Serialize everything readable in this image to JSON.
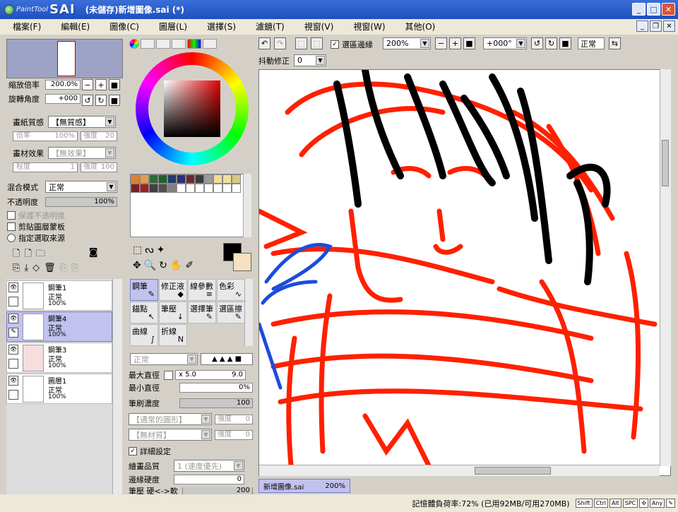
{
  "window": {
    "logo_small": "PaintTool",
    "logo_big": "SAI",
    "title": "(未儲存)新增圖像.sai (*)"
  },
  "menu": [
    "檔案(F)",
    "編輯(E)",
    "圖像(C)",
    "圖層(L)",
    "選擇(S)",
    "濾鏡(T)",
    "視窗(V)",
    "視窗(W)",
    "其他(O)"
  ],
  "navigator": {
    "zoom_label": "縮放倍率",
    "zoom_value": "200.0%",
    "rotate_label": "旋轉角度",
    "rotate_value": "+000"
  },
  "paper": {
    "texture_label": "畫紙質感",
    "texture_value": "【無質感】",
    "scale_label": "倍率",
    "scale_value": "100%",
    "strength_label": "強度",
    "strength_value": "20",
    "effect_label": "畫材效果",
    "effect_value": "【無效果】",
    "degree_label": "程度",
    "degree_value": "1",
    "strength2_label": "強度",
    "strength2_value": "100"
  },
  "layer_props": {
    "blend_label": "混合模式",
    "blend_value": "正常",
    "opacity_label": "不透明度",
    "opacity_value": "100%",
    "preserve_label": "保護不透明度",
    "clip_label": "剪貼圖層蒙板",
    "selsrc_label": "指定選取來源"
  },
  "layers": [
    {
      "name": "鋼筆1",
      "mode": "正常",
      "opacity": "100%"
    },
    {
      "name": "鋼筆4",
      "mode": "正常",
      "opacity": "100%"
    },
    {
      "name": "鋼筆3",
      "mode": "正常",
      "opacity": "100%"
    },
    {
      "name": "圖層1",
      "mode": "正常",
      "opacity": "100%"
    }
  ],
  "swatch_colors": [
    "#d9833a",
    "#e0a04a",
    "#2e6a3a",
    "#1f6030",
    "#243a6a",
    "#2a2f78",
    "#6a2a2a",
    "#3a3a3a",
    "#9a9a9a",
    "#f1dd9a",
    "#efe0a0",
    "#d9c880",
    "#7a2020",
    "#a02020",
    "#404040",
    "#505050",
    "#808080",
    "#ffffff",
    "#ffffff",
    "#ffffff",
    "#ffffff",
    "#ffffff",
    "#ffffff",
    "#ffffff"
  ],
  "tools": [
    {
      "name": "鋼筆",
      "icon": "✎"
    },
    {
      "name": "修正液",
      "icon": "◆"
    },
    {
      "name": "線參數",
      "icon": "≡"
    },
    {
      "name": "色彩",
      "icon": "∿"
    },
    {
      "name": "錨點",
      "icon": "↖"
    },
    {
      "name": "筆壓",
      "icon": "↓"
    },
    {
      "name": "選擇筆",
      "icon": "✎"
    },
    {
      "name": "選區擦",
      "icon": "✎"
    },
    {
      "name": "曲線",
      "icon": "∫"
    },
    {
      "name": "折線",
      "icon": "N"
    }
  ],
  "brush": {
    "mode": "正常",
    "maxsize_label": "最大直徑",
    "maxsize_mult": "x 5.0",
    "maxsize_val": "9.0",
    "minsize_label": "最小直徑",
    "minsize_val": "0%",
    "density_label": "筆刷濃度",
    "density_val": "100",
    "shape_label": "【通常的圓形】",
    "shape_strength_label": "強度",
    "shape_strength_val": "0",
    "texture_label": "【無材質】",
    "texture_strength_label": "強度",
    "texture_strength_val": "0",
    "detail_label": "詳細設定",
    "quality_label": "繪畫品質",
    "quality_val": "1 (速度優先)",
    "edge_label": "邊緣硬度",
    "edge_val": "0",
    "pressure_label": "筆壓 硬<->軟",
    "pressure_val": "200"
  },
  "canvas_toolbar": {
    "selection_edge": "選區邊緣",
    "zoom": "200%",
    "angle": "+000°",
    "mode": "正常",
    "stabilizer_label": "抖動修正",
    "stabilizer_value": "0"
  },
  "doc_tab": {
    "name": "新增圖像.sai",
    "zoom": "200%"
  },
  "status": {
    "memory": "記憶體負荷率:72% (已用92MB/可用270MB)",
    "keys": [
      "Shift",
      "Ctrl",
      "Alt",
      "SPC",
      "Any"
    ]
  },
  "colors": {
    "main": "#000000",
    "secondary": "#f7e1c0",
    "title": "#2456c8"
  }
}
